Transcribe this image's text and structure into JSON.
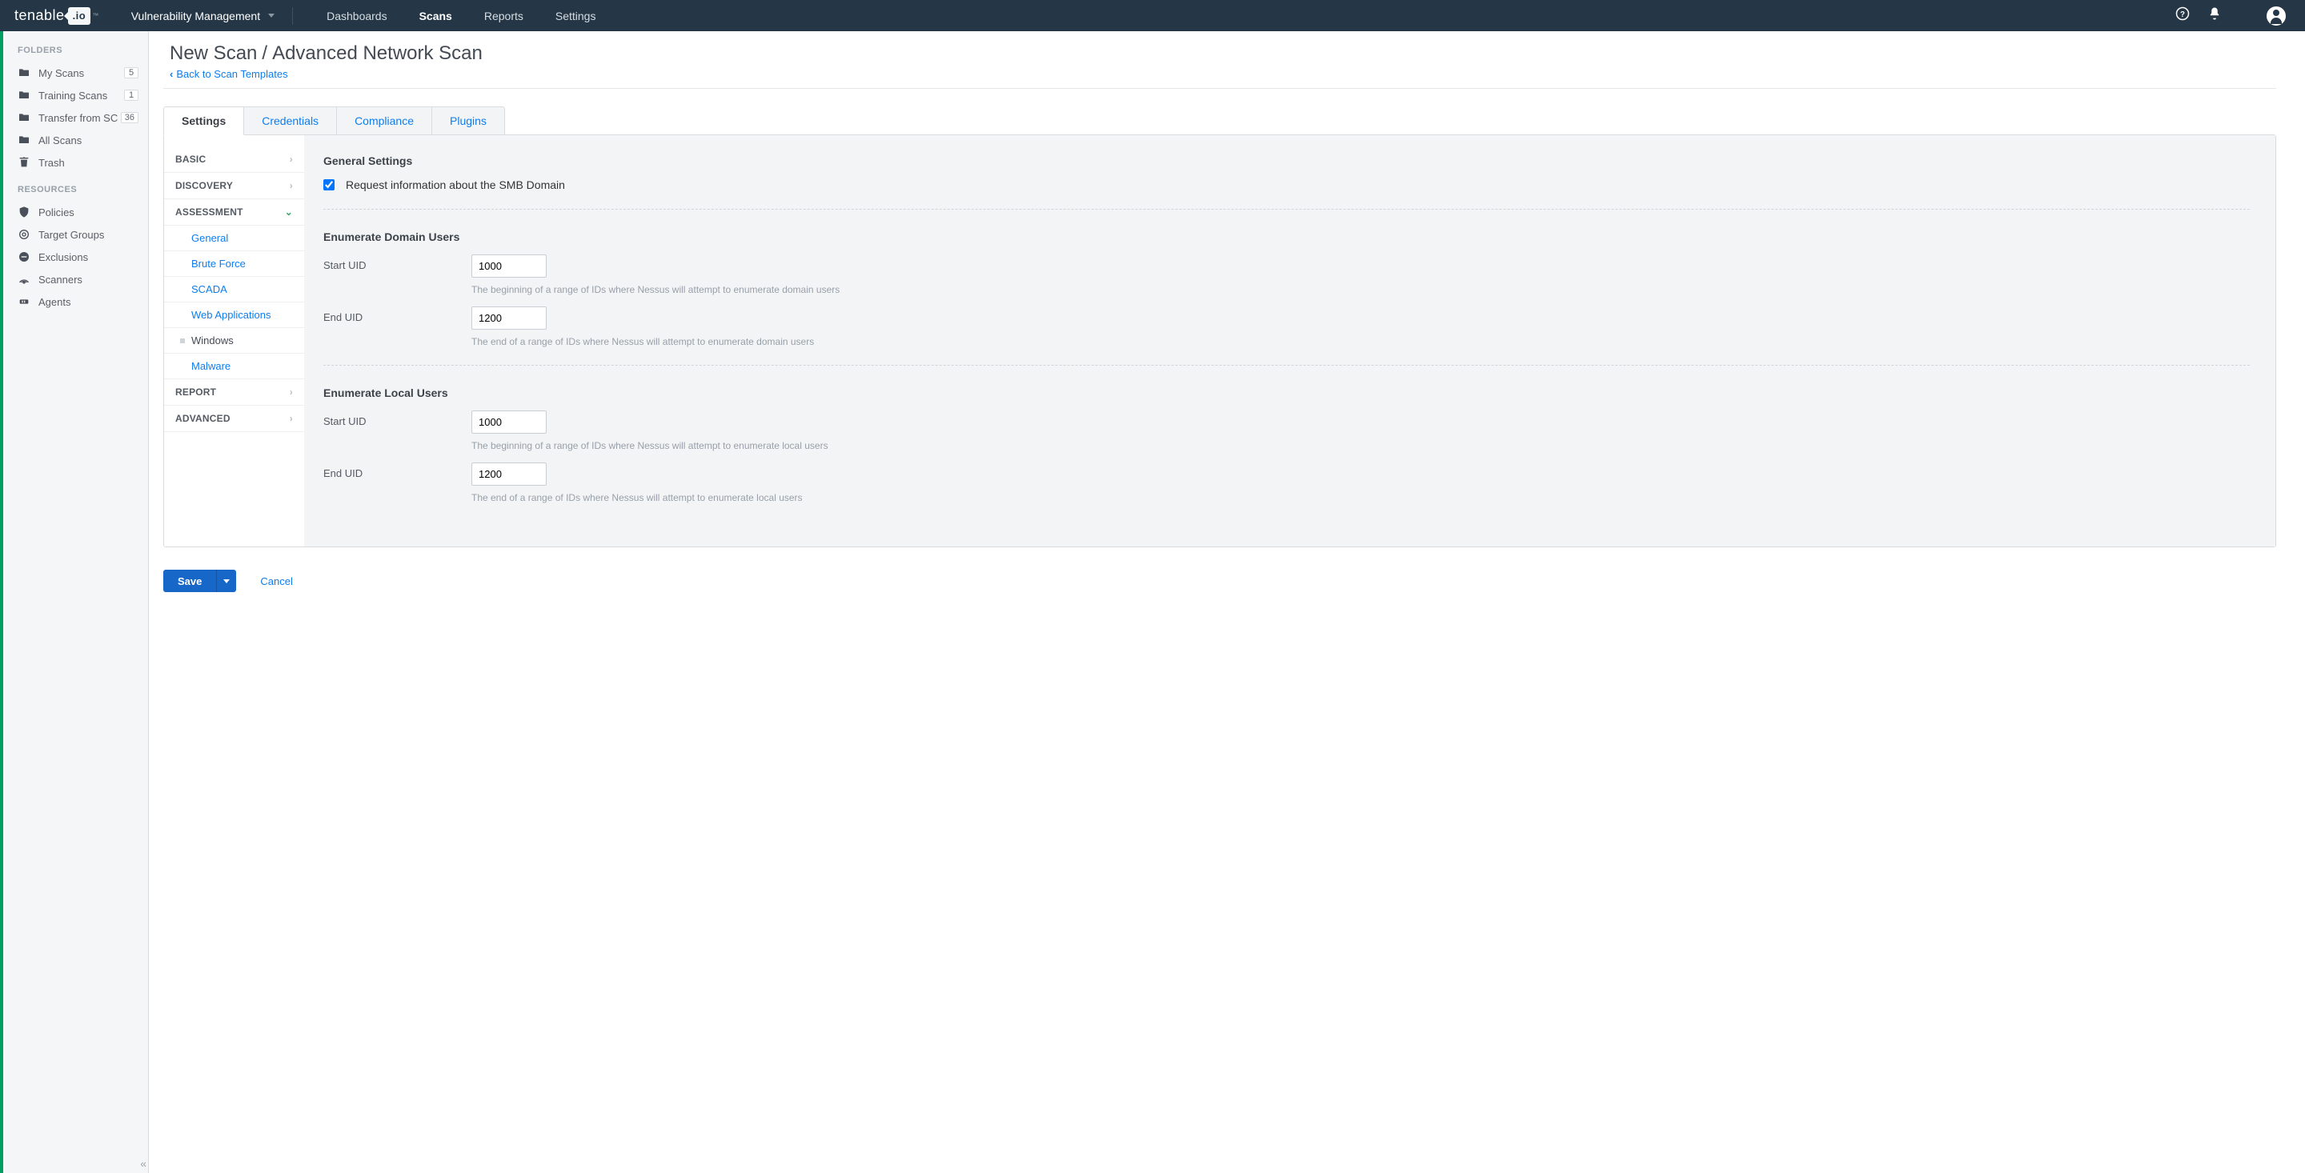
{
  "brand": {
    "name": "tenable",
    "badge": ".io",
    "tm": "™"
  },
  "product_menu": {
    "label": "Vulnerability Management"
  },
  "topnav": [
    {
      "label": "Dashboards",
      "active": false
    },
    {
      "label": "Scans",
      "active": true
    },
    {
      "label": "Reports",
      "active": false
    },
    {
      "label": "Settings",
      "active": false
    }
  ],
  "sidebar": {
    "folders_header": "FOLDERS",
    "folders": [
      {
        "label": "My Scans",
        "count": "5"
      },
      {
        "label": "Training Scans",
        "count": "1"
      },
      {
        "label": "Transfer from SC",
        "count": "36"
      },
      {
        "label": "All Scans",
        "count": ""
      },
      {
        "label": "Trash",
        "count": ""
      }
    ],
    "resources_header": "RESOURCES",
    "resources": [
      {
        "label": "Policies"
      },
      {
        "label": "Target Groups"
      },
      {
        "label": "Exclusions"
      },
      {
        "label": "Scanners"
      },
      {
        "label": "Agents"
      }
    ]
  },
  "page": {
    "title_a": "New Scan",
    "title_sep": "/",
    "title_b": "Advanced Network Scan",
    "backlink": "Back to Scan Templates"
  },
  "config_tabs": [
    {
      "label": "Settings",
      "active": true
    },
    {
      "label": "Credentials",
      "active": false
    },
    {
      "label": "Compliance",
      "active": false
    },
    {
      "label": "Plugins",
      "active": false
    }
  ],
  "settings_tree": {
    "basic": "BASIC",
    "discovery": "DISCOVERY",
    "assessment": "ASSESSMENT",
    "assessment_children": [
      {
        "label": "General",
        "selected": false
      },
      {
        "label": "Brute Force",
        "selected": false
      },
      {
        "label": "SCADA",
        "selected": false
      },
      {
        "label": "Web Applications",
        "selected": false
      },
      {
        "label": "Windows",
        "selected": true
      },
      {
        "label": "Malware",
        "selected": false
      }
    ],
    "report": "REPORT",
    "advanced": "ADVANCED"
  },
  "form": {
    "general_header": "General Settings",
    "request_smb_label": "Request information about the SMB Domain",
    "request_smb_checked": true,
    "enum_domain_header": "Enumerate Domain Users",
    "domain_start_label": "Start UID",
    "domain_start_value": "1000",
    "domain_start_hint": "The beginning of a range of IDs where Nessus will attempt to enumerate domain users",
    "domain_end_label": "End UID",
    "domain_end_value": "1200",
    "domain_end_hint": "The end of a range of IDs where Nessus will attempt to enumerate domain users",
    "enum_local_header": "Enumerate Local Users",
    "local_start_label": "Start UID",
    "local_start_value": "1000",
    "local_start_hint": "The beginning of a range of IDs where Nessus will attempt to enumerate local users",
    "local_end_label": "End UID",
    "local_end_value": "1200",
    "local_end_hint": "The end of a range of IDs where Nessus will attempt to enumerate local users"
  },
  "actions": {
    "save": "Save",
    "cancel": "Cancel"
  }
}
